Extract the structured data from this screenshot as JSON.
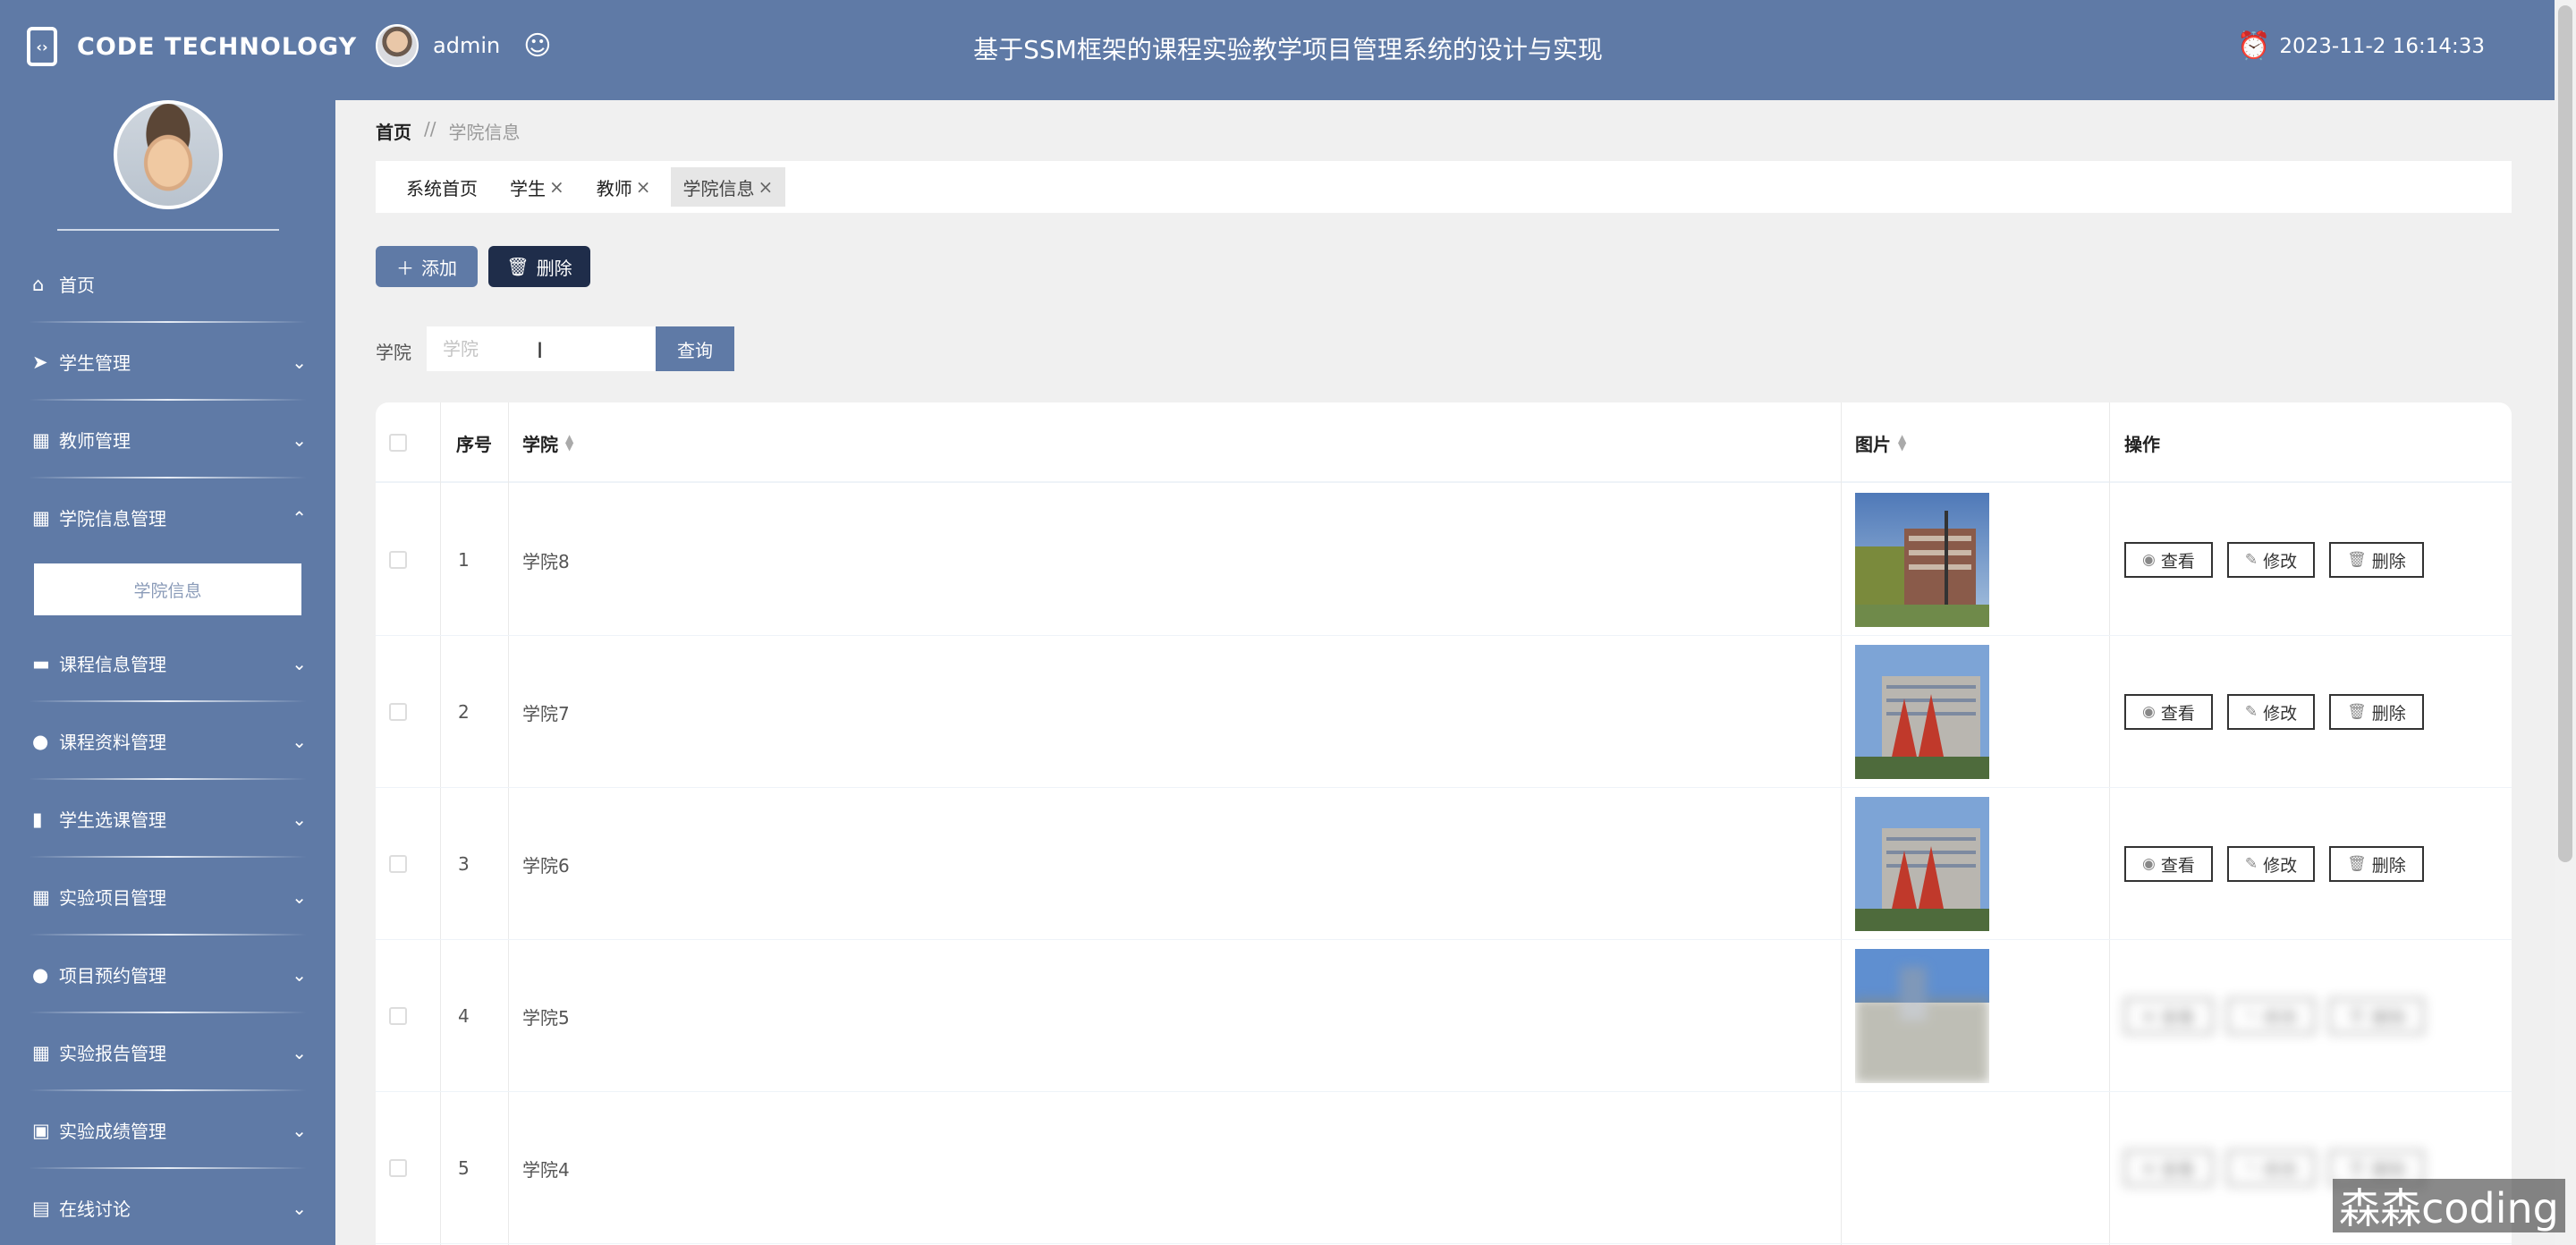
{
  "header": {
    "brand": "CODE TECHNOLOGY",
    "username": "admin",
    "system_title": "基于SSM框架的课程实验教学项目管理系统的设计与实现",
    "datetime": "2023-11-2 16:14:33",
    "colors": {
      "primary": "#5f7aa6",
      "dark": "#1f2d4a"
    }
  },
  "sidebar": {
    "items": [
      {
        "label": "首页",
        "icon": "home-icon"
      },
      {
        "label": "学生管理",
        "icon": "send-icon"
      },
      {
        "label": "教师管理",
        "icon": "grid-icon"
      },
      {
        "label": "学院信息管理",
        "icon": "grid-icon",
        "expanded": true
      },
      {
        "label": "课程信息管理",
        "icon": "chat-icon"
      },
      {
        "label": "课程资料管理",
        "icon": "user-icon"
      },
      {
        "label": "学生选课管理",
        "icon": "bar-chart-icon"
      },
      {
        "label": "实验项目管理",
        "icon": "grid-icon"
      },
      {
        "label": "项目预约管理",
        "icon": "bulb-icon"
      },
      {
        "label": "实验报告管理",
        "icon": "table-icon"
      },
      {
        "label": "实验成绩管理",
        "icon": "clipboard-icon"
      },
      {
        "label": "在线讨论",
        "icon": "book-icon"
      }
    ],
    "submenu_active": "学院信息"
  },
  "breadcrumb": {
    "home": "首页",
    "separator": "//",
    "current": "学院信息"
  },
  "tabs": [
    {
      "label": "系统首页",
      "closable": false
    },
    {
      "label": "学生",
      "closable": true
    },
    {
      "label": "教师",
      "closable": true
    },
    {
      "label": "学院信息",
      "closable": true,
      "active": true
    }
  ],
  "toolbar": {
    "add_label": "添加",
    "delete_label": "删除"
  },
  "search": {
    "label": "学院",
    "placeholder": "学院",
    "button": "查询"
  },
  "table": {
    "columns": {
      "index": "序号",
      "college": "学院",
      "image": "图片",
      "actions": "操作"
    },
    "actions": {
      "view": "查看",
      "edit": "修改",
      "delete": "删除"
    },
    "rows": [
      {
        "index": "1",
        "college": "学院8"
      },
      {
        "index": "2",
        "college": "学院7"
      },
      {
        "index": "3",
        "college": "学院6"
      },
      {
        "index": "4",
        "college": "学院5"
      },
      {
        "index": "5",
        "college": "学院4"
      }
    ]
  },
  "watermark": "森森coding"
}
